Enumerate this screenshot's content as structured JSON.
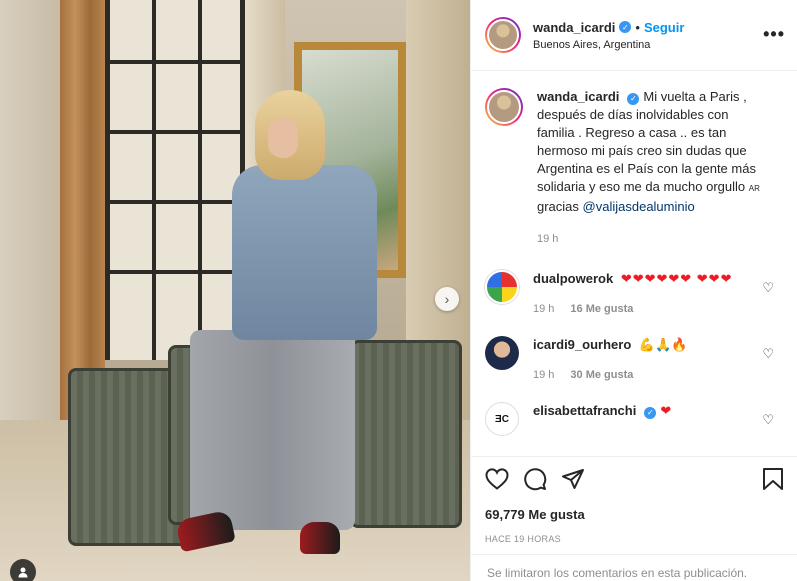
{
  "post": {
    "username": "wanda_icardi",
    "follow_label": "Seguir",
    "separator": "•",
    "location": "Buenos Aires, Argentina",
    "more_label": "•••"
  },
  "caption": {
    "username": "wanda_icardi",
    "text": "Mi vuelta a Paris , después de días inolvidables con familia . Regreso a casa .. es tan hermoso mi país creo sin dudas que Argentina es el País con la gente más solidaria y eso me da mucho orgullo ",
    "flag": "AR",
    "thanks": " gracias ",
    "mention": "@valijasdealuminio",
    "time": "19 h"
  },
  "comments": [
    {
      "username": "dualpowerok",
      "text": "❤❤❤❤❤❤ ❤❤❤",
      "time": "19 h",
      "likes": "16 Me gusta"
    },
    {
      "username": "icardi9_ourhero",
      "text": "💪🙏🔥",
      "time": "19 h",
      "likes": "30 Me gusta"
    },
    {
      "username": "elisabettafranchi",
      "text": "❤",
      "verified": true
    }
  ],
  "stats": {
    "likes": "69,779 Me gusta",
    "time_ago": "HACE 19 HORAS",
    "comments_closed": "Se limitaron los comentarios en esta publicación."
  },
  "icons": [
    "heart-icon",
    "comment-icon",
    "share-icon",
    "bookmark-icon",
    "chevron-right-icon",
    "user-tag-icon",
    "verified-icon",
    "more-icon"
  ],
  "colors": {
    "link": "#0095f6",
    "verified": "#3897f0",
    "muted": "#8e8e8e",
    "heart": "#ed1c24"
  }
}
